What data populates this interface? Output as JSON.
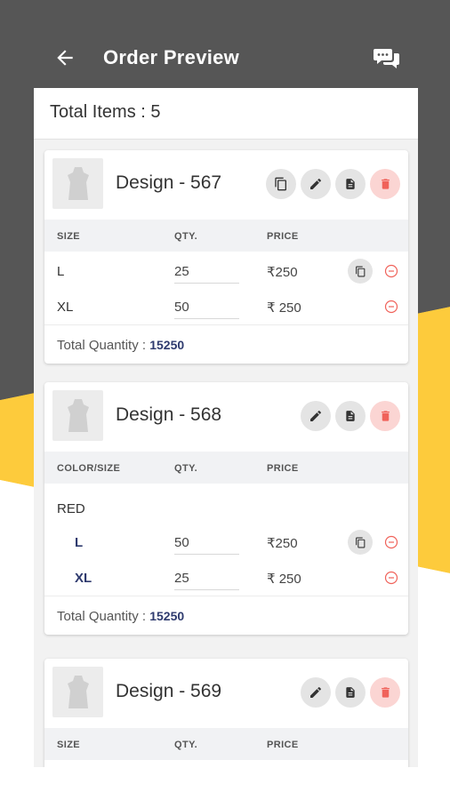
{
  "header": {
    "title": "Order Preview",
    "back_icon": "arrow-left-icon",
    "chat_icon": "chat-bubbles-icon"
  },
  "summary": {
    "total_items": "Total Items : 5"
  },
  "colors": {
    "dark": "#565656",
    "yellow": "#fdcb3c",
    "danger": "#f0625a",
    "navy": "#2e3a6e"
  },
  "cards": [
    {
      "name": "Design - 567",
      "columns": [
        "SIZE",
        "QTY.",
        "PRICE"
      ],
      "rows": [
        {
          "size": "L",
          "qty": "25",
          "price": "₹250"
        },
        {
          "size": "XL",
          "qty": "50",
          "price": "₹ 250"
        }
      ],
      "total_label": "Total Quantity :",
      "total_value": "15250"
    },
    {
      "name": "Design - 568",
      "columns": [
        "COLOR/SIZE",
        "QTY.",
        "PRICE"
      ],
      "color": "RED",
      "rows": [
        {
          "size": "L",
          "qty": "50",
          "price": "₹250"
        },
        {
          "size": "XL",
          "qty": "25",
          "price": "₹ 250"
        }
      ],
      "total_label": "Total Quantity :",
      "total_value": "15250"
    },
    {
      "name": "Design - 569",
      "columns": [
        "SIZE",
        "QTY.",
        "PRICE"
      ]
    }
  ]
}
